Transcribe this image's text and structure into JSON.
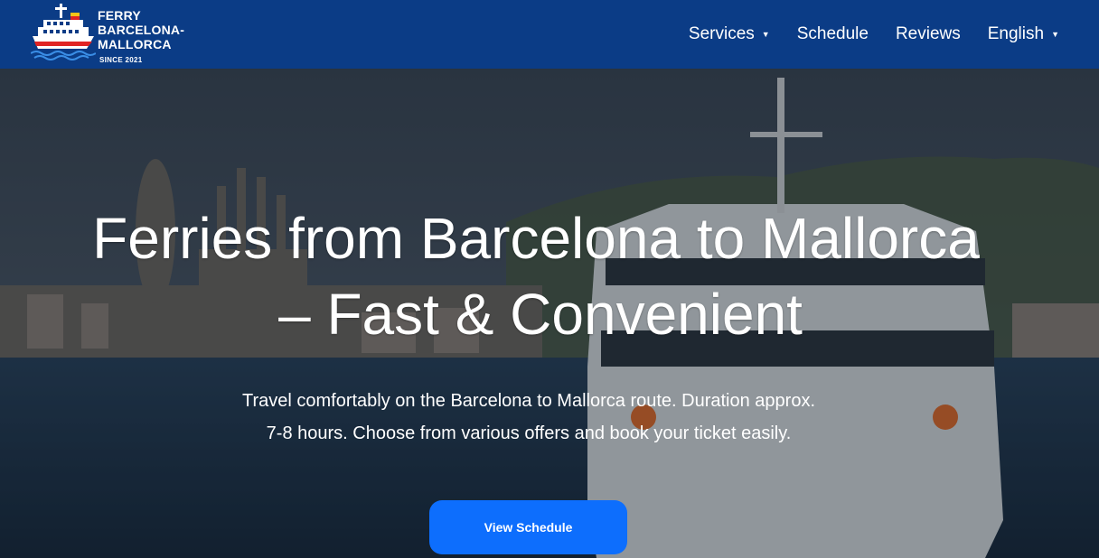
{
  "logo": {
    "line1": "FERRY",
    "line2": "BARCELONA-",
    "line3": "MALLORCA",
    "since": "SINCE 2021",
    "icon": "ferry-ship-icon"
  },
  "nav": {
    "services": "Services",
    "schedule": "Schedule",
    "reviews": "Reviews",
    "language": "English",
    "caret_icon": "caret-down-icon"
  },
  "hero": {
    "title_line1": "Ferries from Barcelona to Mallorca",
    "title_line2": "– Fast & Convenient",
    "subtitle_line1": "Travel comfortably on the Barcelona to Mallorca route. Duration approx.",
    "subtitle_line2": "7-8 hours. Choose from various offers and book your ticket easily.",
    "cta": "View Schedule"
  },
  "colors": {
    "navbar": "#0b3c86",
    "cta": "#0d6efd",
    "text": "#ffffff"
  }
}
